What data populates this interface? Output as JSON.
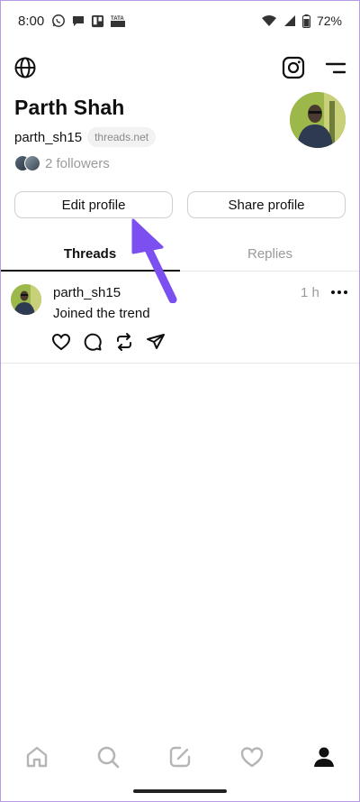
{
  "status_bar": {
    "time": "8:00",
    "battery": "72%",
    "notification_icons": [
      "whatsapp-icon",
      "chat-bubble-icon",
      "trello-icon",
      "tata-app-icon"
    ],
    "system_icons": [
      "wifi-icon",
      "cellular-signal-icon",
      "battery-icon"
    ]
  },
  "toolbar": {
    "left_icon": "globe-icon",
    "right_icons": [
      "instagram-icon",
      "menu-icon"
    ]
  },
  "profile": {
    "name": "Parth Shah",
    "handle": "parth_sh15",
    "domain": "threads.net",
    "followers": "2 followers",
    "avatar": "profile-photo"
  },
  "buttons": {
    "edit": "Edit profile",
    "share": "Share profile"
  },
  "tabs": [
    {
      "label": "Threads",
      "active": true
    },
    {
      "label": "Replies",
      "active": false
    }
  ],
  "posts": [
    {
      "username": "parth_sh15",
      "time": "1 h",
      "text": "Joined the trend",
      "actions": [
        "like-icon",
        "reply-icon",
        "repost-icon",
        "share-icon"
      ]
    }
  ],
  "annotation": {
    "arrow_color": "#7b4ff0",
    "points_to": "Edit profile"
  },
  "bottom_nav": [
    "home-icon",
    "search-icon",
    "compose-icon",
    "activity-icon",
    "profile-icon"
  ],
  "colors": {
    "text": "#101010",
    "muted": "#9a9a9a",
    "border": "#cfcfcf",
    "accent_arrow": "#7b4ff0"
  }
}
